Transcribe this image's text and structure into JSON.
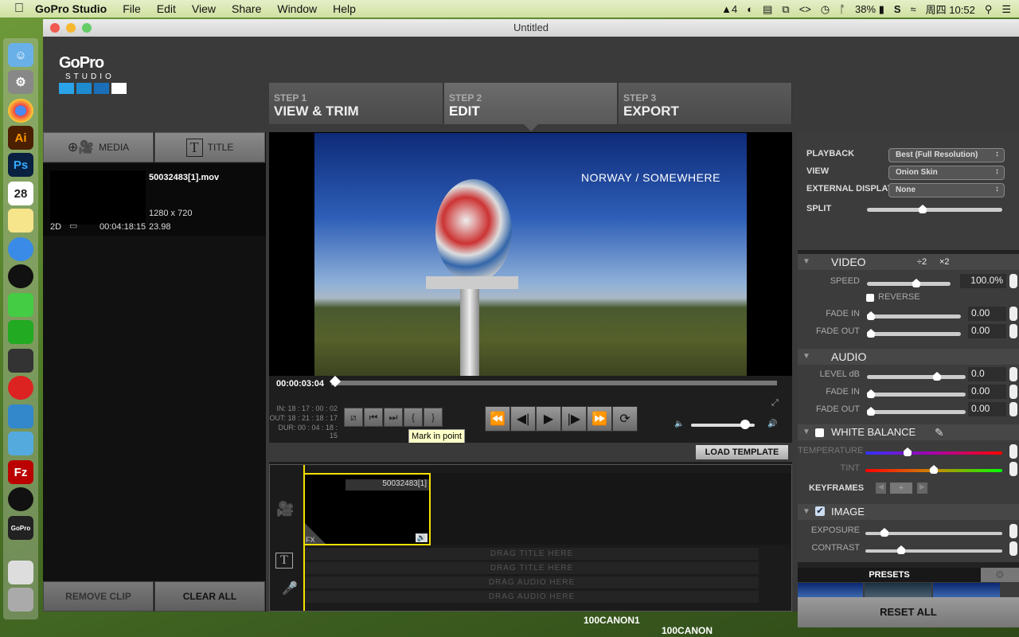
{
  "menubar": {
    "app": "GoPro Studio",
    "items": [
      "File",
      "Edit",
      "View",
      "Share",
      "Window",
      "Help"
    ],
    "status": {
      "adobe": "4",
      "battery": "38%",
      "clock": "周四 10:52"
    }
  },
  "window": {
    "title": "Untitled"
  },
  "logo": {
    "brand": "GoPro",
    "sub": "STUDIO"
  },
  "steps": [
    {
      "num": "STEP 1",
      "label": "VIEW & TRIM"
    },
    {
      "num": "STEP 2",
      "label": "EDIT"
    },
    {
      "num": "STEP 3",
      "label": "EXPORT"
    }
  ],
  "left": {
    "tabs": {
      "media": "MEDIA",
      "title": "TITLE"
    },
    "clip": {
      "name": "50032483[1].mov",
      "resolution": "1280 x 720",
      "mode": "2D",
      "duration": "00:04:18:15",
      "fps": "23.98"
    },
    "remove": "REMOVE CLIP",
    "clear": "CLEAR ALL"
  },
  "player": {
    "overlay_text": "NORWAY / SOMEWHERE",
    "timecode": "00:00:03:04",
    "in": "IN: 18 : 17 : 00 : 02",
    "out": "OUT: 18 : 21 : 18 : 17",
    "dur": "DUR: 00 : 04 : 18 : 15",
    "tooltip": "Mark in point",
    "progress": 0.01,
    "volume": 0.85
  },
  "load_template": "LOAD TEMPLATE",
  "timeline": {
    "clip_label": "50032483[1]",
    "fx": "FX",
    "drag_title": "DRAG TITLE HERE",
    "drag_audio": "DRAG AUDIO HERE"
  },
  "right": {
    "playback": {
      "label": "PLAYBACK",
      "value": "Best (Full Resolution)"
    },
    "view": {
      "label": "VIEW",
      "value": "Onion Skin"
    },
    "external": {
      "label": "EXTERNAL DISPLAY",
      "value": "None"
    },
    "split": {
      "label": "SPLIT",
      "level": 0.5
    },
    "video": {
      "title": "VIDEO",
      "half": "÷2",
      "double": "×2",
      "speed_label": "SPEED",
      "speed": "100.0%",
      "reverse": "REVERSE",
      "fade_in_label": "FADE IN",
      "fade_in": "0.00",
      "fade_out_label": "FADE OUT",
      "fade_out": "0.00"
    },
    "audio": {
      "title": "AUDIO",
      "level_label": "LEVEL dB",
      "level": "0.0",
      "fade_in_label": "FADE IN",
      "fade_in": "0.00",
      "fade_out_label": "FADE OUT",
      "fade_out": "0.00"
    },
    "wb": {
      "title": "WHITE BALANCE",
      "temperature": "TEMPERATURE",
      "tint": "TINT",
      "keyframes": "KEYFRAMES",
      "enabled": false
    },
    "image": {
      "title": "IMAGE",
      "exposure": "EXPOSURE",
      "contrast": "CONTRAST",
      "enabled": true
    },
    "presets": "PRESETS",
    "reset": "RESET ALL"
  },
  "desktop": {
    "folders": [
      "100CANON1",
      "100CANON"
    ]
  }
}
